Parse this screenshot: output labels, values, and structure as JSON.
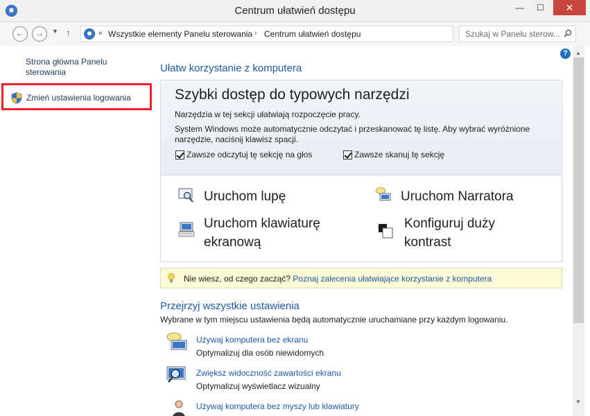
{
  "window": {
    "title": "Centrum ułatwień dostępu",
    "minimize": "—",
    "maximize": "☐",
    "close": "✕"
  },
  "nav": {
    "back": "←",
    "forward": "→",
    "recent": "▼",
    "up": "↑",
    "overflow": "«",
    "separator": "›",
    "breadcrumbs": [
      "Wszystkie elementy Panelu sterowania",
      "Centrum ułatwień dostępu"
    ],
    "address_dropdown": "▼",
    "refresh": "↻",
    "search_placeholder": "Szukaj w Panelu sterow..."
  },
  "sidebar": {
    "home_link": "Strona główna Panelu sterowania",
    "items": [
      {
        "label": "Zmień ustawienia logowania",
        "icon": "uac-shield-icon"
      }
    ]
  },
  "help": "?",
  "main": {
    "section_title": "Ułatw korzystanie z komputera",
    "quick": {
      "title": "Szybki dostęp do typowych narzędzi",
      "desc1": "Narzędzia w tej sekcji ułatwiają rozpoczęcie pracy.",
      "desc2": "System Windows może automatycznie odczytać i przeskanować tę listę. Aby wybrać wyróżnione narzędzie, naciśnij klawisz spacji.",
      "checkbox_read": {
        "label": "Zawsze odczytuj tę sekcję na głos",
        "checked": true
      },
      "checkbox_scan": {
        "label": "Zawsze skanuj tę sekcję",
        "checked": true
      },
      "tools": [
        {
          "label": "Uruchom lupę",
          "icon": "magnifier-icon"
        },
        {
          "label": "Uruchom Narratora",
          "icon": "narrator-icon"
        },
        {
          "label": "Uruchom klawiaturę ekranową",
          "icon": "keyboard-icon"
        },
        {
          "label": "Konfiguruj duży kontrast",
          "icon": "contrast-icon"
        }
      ]
    },
    "tip": {
      "text": "Nie wiesz, od czego zacząć?",
      "link": "Poznaj zalecenia ułatwiające korzystanie z komputera"
    },
    "all_settings": {
      "title": "Przejrzyj wszystkie ustawienia",
      "desc": "Wybrane w tym miejscu ustawienia będą automatycznie uruchamiane przy każdym logowaniu.",
      "items": [
        {
          "link": "Używaj komputera bez ekranu",
          "desc": "Optymalizuj dla osób niewidomych",
          "icon": "speech-monitor-icon"
        },
        {
          "link": "Zwiększ widoczność zawartości ekranu",
          "desc": "Optymalizuj wyświetlacz wizualny",
          "icon": "magnify-monitor-icon"
        },
        {
          "link": "Używaj komputera bez myszy lub klawiatury",
          "desc": "",
          "icon": "person-icon"
        }
      ]
    }
  },
  "scrollbar": {
    "up": "▲",
    "down": "▼"
  }
}
